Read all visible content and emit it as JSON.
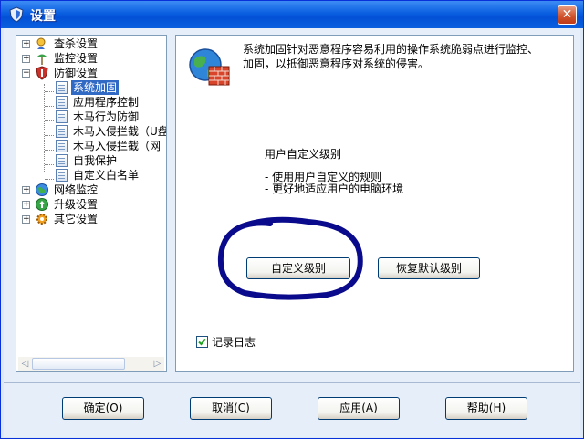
{
  "window": {
    "title": "设置",
    "close_label": "✕"
  },
  "tree": {
    "items": [
      {
        "label": "查杀设置",
        "expander": "+",
        "icon": "scan-icon"
      },
      {
        "label": "监控设置",
        "expander": "+",
        "icon": "monitor-icon"
      },
      {
        "label": "防御设置",
        "expander": "−",
        "icon": "shield-icon"
      },
      {
        "label": "系统加固",
        "icon": "page-icon",
        "selected": true
      },
      {
        "label": "应用程序控制",
        "icon": "page-icon"
      },
      {
        "label": "木马行为防御",
        "icon": "page-icon"
      },
      {
        "label": "木马入侵拦截（U盘",
        "icon": "page-icon"
      },
      {
        "label": "木马入侵拦截（网",
        "icon": "page-icon"
      },
      {
        "label": "自我保护",
        "icon": "page-icon"
      },
      {
        "label": "自定义白名单",
        "icon": "page-icon"
      },
      {
        "label": "网络监控",
        "expander": "+",
        "icon": "network-icon"
      },
      {
        "label": "升级设置",
        "expander": "+",
        "icon": "update-icon"
      },
      {
        "label": "其它设置",
        "expander": "+",
        "icon": "other-settings-icon"
      }
    ],
    "scroll_left": "◁",
    "scroll_right": "▷"
  },
  "content": {
    "description": "系统加固针对恶意程序容易利用的操作系统脆弱点进行监控、加固，以抵御恶意程序对系统的侵害。",
    "level_title": "用户自定义级别",
    "bullets": [
      "- 使用用户自定义的规则",
      "- 更好地适应用户的电脑环境"
    ],
    "custom_level_button": "自定义级别",
    "restore_default_button": "恢复默认级别",
    "log_checkbox_label": "记录日志",
    "log_checked": true
  },
  "footer": {
    "ok": "确定(O)",
    "cancel": "取消(C)",
    "apply": "应用(A)",
    "help": "帮助(H)"
  },
  "colors": {
    "titlebar": "#0a5fe0",
    "selection": "#316ac5",
    "annotation_circle": "#0a0a8c"
  }
}
